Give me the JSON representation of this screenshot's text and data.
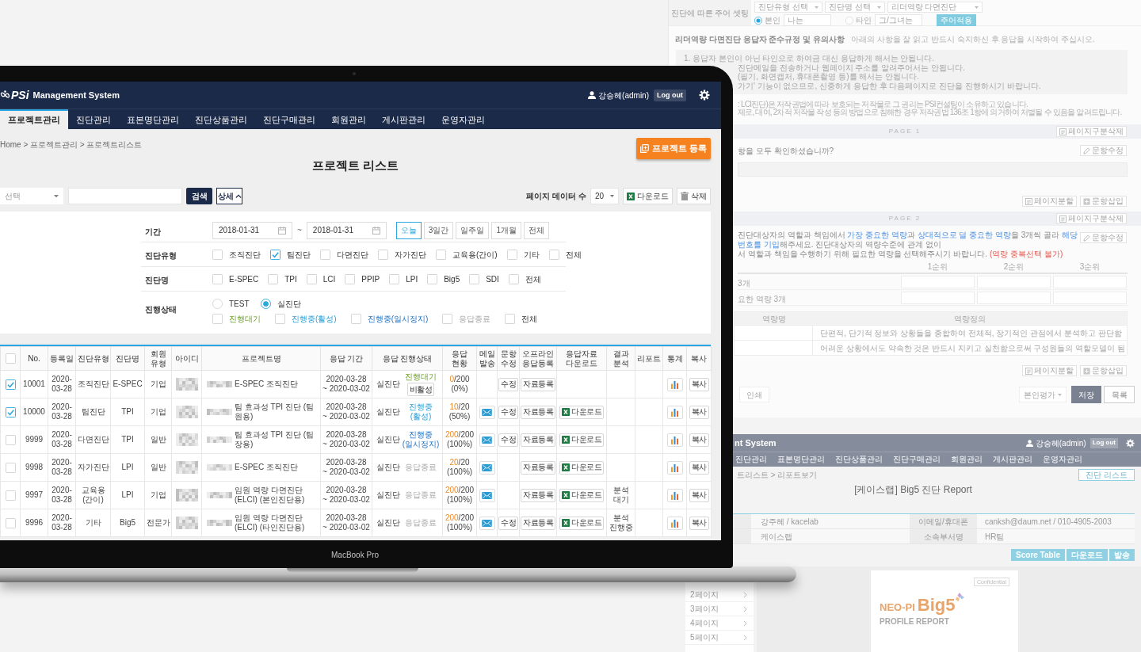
{
  "device": {
    "label": "MacBook Pro"
  },
  "app": {
    "header": {
      "logo": "PSi",
      "title": "Management System",
      "user": "강승혜(admin)",
      "logout": "Log out"
    },
    "nav": [
      {
        "label": "프로젝트관리",
        "selected": true
      },
      {
        "label": "진단관리",
        "selected": false
      },
      {
        "label": "표본명단관리",
        "selected": false
      },
      {
        "label": "진단상품관리",
        "selected": false
      },
      {
        "label": "진단구매관리",
        "selected": false
      },
      {
        "label": "회원관리",
        "selected": false
      },
      {
        "label": "게시판관리",
        "selected": false
      },
      {
        "label": "운영자관리",
        "selected": false
      }
    ],
    "breadcrumb": "Home > 프로젝트관리 > 프로젝트리스트",
    "register_button": "프로젝트 등록",
    "title": "프로젝트 리스트",
    "search": {
      "select_placeholder": "선택",
      "search_button": "검색",
      "detail_button": "상세",
      "detail_expanded": true
    },
    "toolbar": {
      "page_size_label": "페이지 데이터 수",
      "page_size": "20",
      "download_button": "다운로드",
      "delete_button": "삭제"
    },
    "filters": {
      "period": {
        "label": "기간",
        "from": "2018-01-31",
        "separator": "~",
        "to": "2018-01-31",
        "ranges": [
          {
            "label": "오늘",
            "selected": true
          },
          {
            "label": "3일간",
            "selected": false
          },
          {
            "label": "일주일",
            "selected": false
          },
          {
            "label": "1개월",
            "selected": false
          },
          {
            "label": "전체",
            "selected": false
          }
        ]
      },
      "type": {
        "label": "진단유형",
        "options": [
          {
            "label": "조직진단",
            "checked": false
          },
          {
            "label": "팀진단",
            "checked": true
          },
          {
            "label": "다면진단",
            "checked": false
          },
          {
            "label": "자가진단",
            "checked": false
          },
          {
            "label": "교육용(간이)",
            "checked": false
          },
          {
            "label": "기타",
            "checked": false
          },
          {
            "label": "전체",
            "checked": false
          }
        ]
      },
      "name": {
        "label": "진단명",
        "options": [
          {
            "label": "E-SPEC",
            "checked": false
          },
          {
            "label": "TPI",
            "checked": false
          },
          {
            "label": "LCI",
            "checked": false
          },
          {
            "label": "PPIP",
            "checked": false
          },
          {
            "label": "LPI",
            "checked": false
          },
          {
            "label": "Big5",
            "checked": false
          },
          {
            "label": "SDI",
            "checked": false
          },
          {
            "label": "전체",
            "checked": false
          }
        ]
      },
      "status": {
        "label": "진행상태",
        "modes": [
          {
            "label": "TEST",
            "selected": false
          },
          {
            "label": "실진단",
            "selected": true
          }
        ],
        "options": [
          {
            "label": "진행대기",
            "checked": false,
            "kind": "waiting"
          },
          {
            "label": "진행중(활성)",
            "checked": false,
            "kind": "active"
          },
          {
            "label": "진행중(일시정지)",
            "checked": false,
            "kind": "paused"
          },
          {
            "label": "응답종료",
            "checked": false,
            "kind": "closed"
          },
          {
            "label": "전체",
            "checked": false,
            "kind": "all"
          }
        ]
      }
    },
    "table": {
      "all_checked": false,
      "columns": [
        "No.",
        "등록일",
        "진단유형",
        "진단명",
        "회원 유형",
        "아이디",
        "프로젝트명",
        "응답 기간",
        "응답 진행상태",
        "응답 현황",
        "메일 발송",
        "문항 수정",
        "오프라인 응답등록",
        "응답자료 다운로드",
        "결과 분석",
        "리포트",
        "통계",
        "복사"
      ],
      "rows": [
        {
          "checked": true,
          "no": "10001",
          "date": "2020-03-28",
          "type": "조직진단",
          "name": "E-SPEC",
          "member": "기업",
          "project": "E-SPEC 조직진단",
          "period_start": "2020-03-28",
          "period_end": "~ 2020-03-02",
          "mode": "실진단",
          "status": {
            "label": "진행대기",
            "kind": "waiting"
          },
          "status_button": "비활성",
          "answered": "0",
          "total": "/200",
          "percent": "(0%)",
          "mail": false,
          "edit_button": "수정",
          "offline_button": "자료등록",
          "copy_button": "복사"
        },
        {
          "checked": true,
          "no": "10000",
          "date": "2020-03-28",
          "type": "팀진단",
          "name": "TPI",
          "member": "기업",
          "project": "팀 효과성 TPI 진단 (팀원용)",
          "period_start": "2020-03-28",
          "period_end": "~ 2020-03-02",
          "mode": "실진단",
          "status": {
            "label": "진행중 (활성)",
            "kind": "active"
          },
          "answered": "10",
          "total": "/20",
          "percent": "(50%)",
          "mail": true,
          "edit_button": "수정",
          "offline_button": "자료등록",
          "download_button": "다운로드",
          "copy_button": "복사"
        },
        {
          "checked": false,
          "no": "9999",
          "date": "2020-03-28",
          "type": "다면진단",
          "name": "TPI",
          "member": "일반",
          "project": "팀 효과성 TPI 진단 (팀장용)",
          "period_start": "2020-03-28",
          "period_end": "~ 2020-03-02",
          "mode": "실진단",
          "status": {
            "label": "진행중 (일시정지)",
            "kind": "paused"
          },
          "answered": "200",
          "total": "/200",
          "percent": "(100%)",
          "mail": true,
          "edit_button": "수정",
          "offline_button": "자료등록",
          "download_button": "다운로드",
          "copy_button": "복사"
        },
        {
          "checked": false,
          "no": "9998",
          "date": "2020-03-28",
          "type": "자가진단",
          "name": "LPI",
          "member": "일반",
          "project": "E-SPEC 조직진단",
          "period_start": "2020-03-28",
          "period_end": "~ 2020-03-02",
          "mode": "실진단",
          "status": {
            "label": "응답종료",
            "kind": "closed"
          },
          "answered": "20",
          "total": "/20",
          "percent": "(100%)",
          "mail": true,
          "offline_button": "자료등록",
          "download_button": "다운로드",
          "copy_button": "복사"
        },
        {
          "checked": false,
          "no": "9997",
          "date": "2020-03-28",
          "type": "교육용 (간이)",
          "name": "LPI",
          "member": "기업",
          "project": "임원 역량 다면진단(ELCI) (본인진단용)",
          "period_start": "2020-03-28",
          "period_end": "~ 2020-03-02",
          "mode": "실진단",
          "status": {
            "label": "응답종료",
            "kind": "closed"
          },
          "answered": "200",
          "total": "/200",
          "percent": "(100%)",
          "mail": true,
          "offline_button": "자료등록",
          "download_button": "다운로드",
          "analysis": "분석 대기",
          "copy_button": "복사"
        },
        {
          "checked": false,
          "no": "9996",
          "date": "2020-03-28",
          "type": "기타",
          "name": "Big5",
          "member": "전문가",
          "project": "임원 역량 다면진단(ELCI) (타인진단용)",
          "period_start": "2020-03-28",
          "period_end": "~ 2020-03-02",
          "mode": "실진단",
          "status": {
            "label": "응답종료",
            "kind": "closed"
          },
          "answered": "200",
          "total": "/200",
          "percent": "(100%)",
          "mail": true,
          "edit_button": "수정",
          "offline_button": "자료등록",
          "download_button": "다운로드",
          "analysis": "분석 진행중",
          "copy_button": "복사"
        }
      ]
    }
  },
  "editor": {
    "subject_setting": {
      "label": "진단에 따른 주어 셋팅",
      "selects": [
        "진단유형 선택",
        "진단명 선택",
        "리더역량 다면진단"
      ],
      "subjects": [
        {
          "label": "본인",
          "value": "나는",
          "selected": true
        },
        {
          "label": "타인",
          "value": "그/그녀는",
          "selected": false
        }
      ],
      "apply_button": "주어적용"
    },
    "notice": {
      "title": "리더역량 다면진단 응답자 준수규정 및 유의사항",
      "hint": "아래의 사항을 잘 읽고 반드시 숙지하신 후 응답을 시작하여 주십시오.",
      "items": [
        "1. 응답자 본인이 아닌 타인으로 하여금 대신 응답하게 해서는 안됩니다.",
        "진단메일을 전송하거나 웹페이지 주소를 알려주어서는 안됩니다.",
        "(필기, 화면캡처, 휴대폰촬영 등)를 해서는 안됩니다.",
        "가기' 기능이 없으므로, 신중하게 응답한 후 다음페이지로 진단을 진행하시기 바랍니다."
      ],
      "copyright": [
        ": LCI진단)은 저작권법에 따라 보호되는 저작물로 그 권리는 PSI컨설팅이 소유하고 있습니다.",
        "제로, 대여, 2차적 저작물 작성 등의 방법으로 침해한 경우 저작권법 136조 1항에 의거하여 처벌될 수 있음을 알려드립니다."
      ]
    },
    "page_1": {
      "label": "PAGE 1",
      "delete_button": "페이지구분삭제",
      "question": "항을 모두 확인하셨습니까?",
      "edit_button": "문항수정",
      "split_button": "페이지분할",
      "insert_button": "문항삽입"
    },
    "page_2": {
      "label": "PAGE 2",
      "delete_button": "페이지구분삭제",
      "question": [
        {
          "text": "진단대상자의 역할과 책임에서 ",
          "highlight": false
        },
        {
          "text": "가장 중요한 역량",
          "highlight": true
        },
        {
          "text": "과 ",
          "highlight": false
        },
        {
          "text": "상대적으로 덜 중요한 역량",
          "highlight": true
        },
        {
          "text": "을 3개씩 골라 ",
          "highlight": false
        },
        {
          "text": "해당 번호를 기입",
          "highlight": true
        },
        {
          "text": "해주세요. 진단대상자의 역량수준에 관계 없이",
          "highlight": false
        }
      ],
      "question_line_2": "서 역할과 책임을 수행하기 위해 필요한 역량을 선택해주시기 바랍니다.",
      "note": "(역량 중복선택 불가)",
      "edit_button": "문항수정",
      "ranks": [
        "1순위",
        "2순위",
        "3순위"
      ],
      "rank_rows": [
        "3개",
        "요한 역량 3개"
      ],
      "definition_columns": [
        "역량명",
        "역량정의"
      ],
      "definitions": [
        "단편적, 단기적 정보와 상황들을 종합하여 전체적, 장기적인 관점에서 분석하고 판단함",
        "어려운 상황에서도 약속한 것은 반드시 지키고 실천함으로써 구성원들의 역할모델이 됨"
      ],
      "split_button": "페이지분할",
      "insert_button": "문항삽입"
    },
    "footer": {
      "print_button": "인쇄",
      "evaluation": "본인평가",
      "save_button": "저장",
      "list_button": "목록"
    }
  },
  "report": {
    "header": {
      "title": "nt System",
      "user": "강승혜(admin)",
      "logout": "Log out"
    },
    "nav": [
      "진단관리",
      "표본명단관리",
      "진단상품관리",
      "진단구매관리",
      "회원관리",
      "게시판관리",
      "운영자관리"
    ],
    "breadcrumb": "트리스트 > 리포트보기",
    "list_button": "진단 리스트",
    "title": "[케이스랩] Big5 진단 Report",
    "info": [
      {
        "value": "강주혜 / kacelab",
        "label": "이메일/휴대폰",
        "detail": "canksh@daum.net / 010-4905-2003"
      },
      {
        "value": "케이스랩",
        "label": "소속부서명",
        "detail": "HR팀"
      }
    ],
    "actions": [
      "Score Table",
      "다운로드",
      "발송"
    ],
    "pages": [
      "2페이지",
      "3페이지",
      "4페이지",
      "5페이지"
    ],
    "preview": {
      "tag": "Confidential",
      "brand": "NEO-PI",
      "product": "Big5",
      "subtitle": "PROFILE REPORT"
    }
  }
}
